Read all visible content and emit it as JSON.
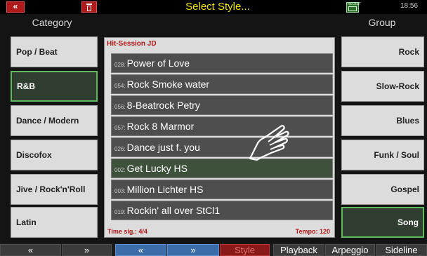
{
  "topbar": {
    "back_label": "«",
    "title": "Select Style...",
    "clock": "18:56",
    "reg_icon_label": "REGIST"
  },
  "category": {
    "header": "Category",
    "items": [
      {
        "label": "Pop / Beat"
      },
      {
        "label": "R&B"
      },
      {
        "label": "Dance / Modern"
      },
      {
        "label": "Discofox"
      },
      {
        "label": "Jive / Rock'n'Roll"
      },
      {
        "label": "Latin"
      }
    ],
    "selected": "R&B"
  },
  "group": {
    "header": "Group",
    "items": [
      {
        "label": "Rock"
      },
      {
        "label": "Slow-Rock"
      },
      {
        "label": "Blues"
      },
      {
        "label": "Funk / Soul"
      },
      {
        "label": "Gospel"
      },
      {
        "label": "Song"
      }
    ],
    "selected": "Song"
  },
  "style_list": {
    "set_name": "Hit-Session JD",
    "items": [
      {
        "num": "028:",
        "name": "Power of Love"
      },
      {
        "num": "054:",
        "name": "Rock Smoke water"
      },
      {
        "num": "056:",
        "name": "8-Beatrock Petry"
      },
      {
        "num": "057:",
        "name": "Rock 8 Marmor"
      },
      {
        "num": "026:",
        "name": "Dance just f. you"
      },
      {
        "num": "002:",
        "name": "Get Lucky HS"
      },
      {
        "num": "003:",
        "name": "Million Lichter HS"
      },
      {
        "num": "019:",
        "name": "Rockin' all over StCl1"
      }
    ],
    "selected": "Get Lucky HS",
    "time_sig": "Time sig.: 4/4",
    "tempo": "Tempo: 120"
  },
  "bottom_tabs": [
    {
      "label": "«"
    },
    {
      "label": "»"
    },
    {
      "label": "«"
    },
    {
      "label": "»"
    },
    {
      "label": "Style"
    },
    {
      "label": "Playback"
    },
    {
      "label": "Arpeggio"
    },
    {
      "label": "Sideline"
    }
  ],
  "colors": {
    "title_yellow": "#f2e200",
    "selection_green": "#5dbb5d",
    "red_accent": "#b01616",
    "blue_tab": "#3d6da8"
  }
}
